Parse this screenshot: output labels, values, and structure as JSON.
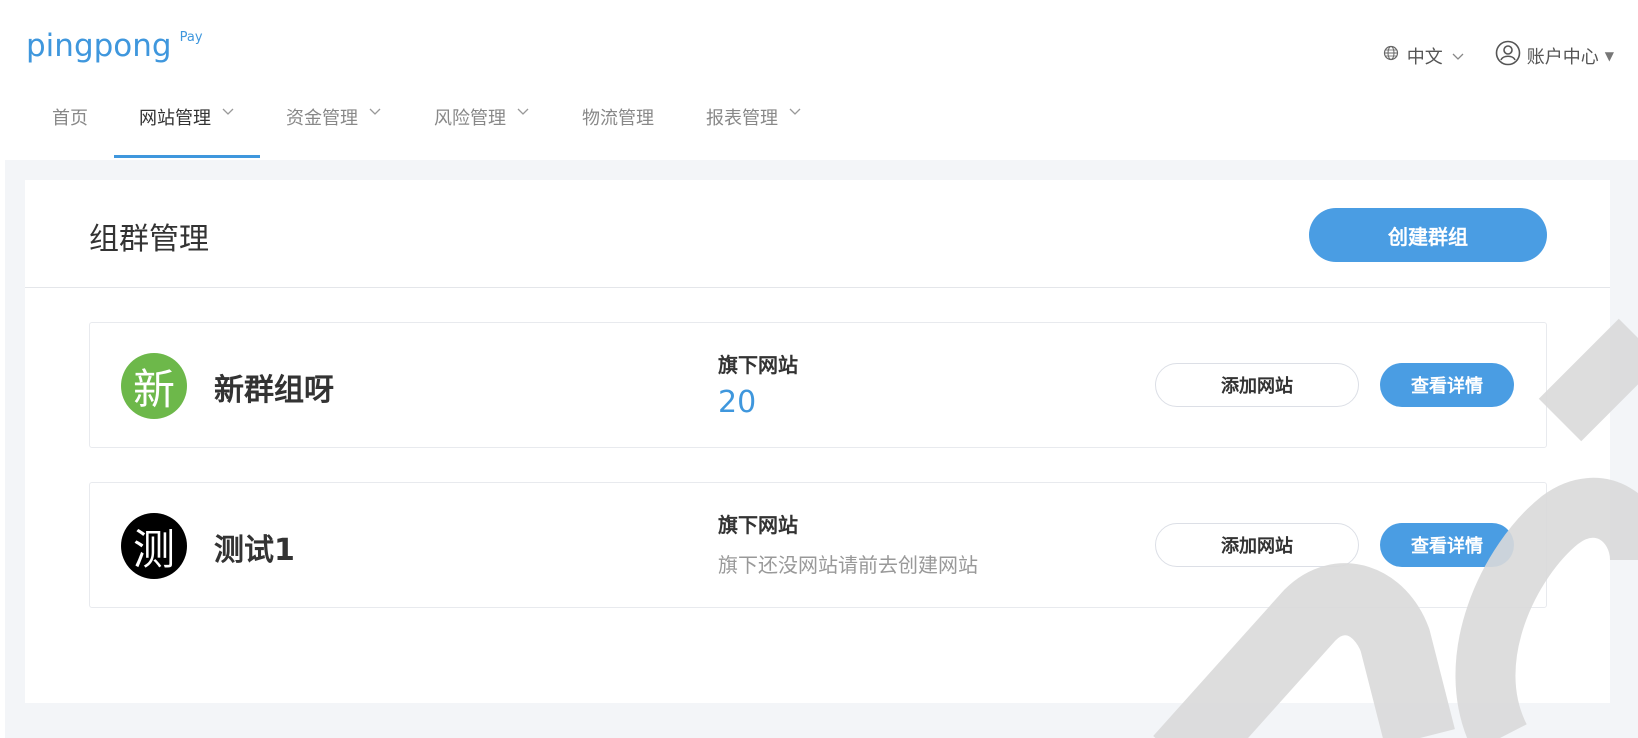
{
  "logo": {
    "main": "pingpong",
    "sub": "Pay"
  },
  "header": {
    "language": "中文",
    "account": "账户中心"
  },
  "nav": {
    "items": [
      {
        "label": "首页"
      },
      {
        "label": "网站管理"
      },
      {
        "label": "资金管理"
      },
      {
        "label": "风险管理"
      },
      {
        "label": "物流管理"
      },
      {
        "label": "报表管理"
      }
    ]
  },
  "page": {
    "title": "组群管理",
    "create_button": "创建群组"
  },
  "groups": [
    {
      "avatar_char": "新",
      "avatar_color": "#6db84a",
      "name": "新群组呀",
      "sites_label": "旗下网站",
      "sites_count": "20",
      "add_button": "添加网站",
      "detail_button": "查看详情"
    },
    {
      "avatar_char": "测",
      "avatar_color": "#000000",
      "name": "测试1",
      "sites_label": "旗下网站",
      "sites_empty": "旗下还没网站请前去创建网站",
      "add_button": "添加网站",
      "detail_button": "查看详情"
    }
  ],
  "colors": {
    "accent": "#4a9de3",
    "background": "#f3f5f8"
  }
}
